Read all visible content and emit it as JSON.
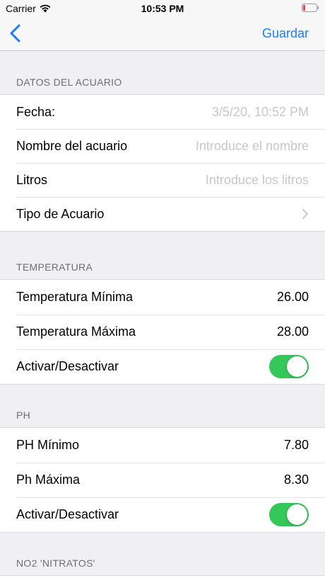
{
  "status": {
    "carrier": "Carrier",
    "time": "10:53 PM",
    "battery_color": "#ff3b30"
  },
  "nav": {
    "save_label": "Guardar",
    "accent": "#1a7cf5"
  },
  "sections": {
    "acuario": {
      "header": "DATOS DEL ACUARIO",
      "fecha_label": "Fecha:",
      "fecha_value": "3/5/20, 10:52 PM",
      "nombre_label": "Nombre del acuario",
      "nombre_placeholder": "Introduce el nombre",
      "litros_label": "Litros",
      "litros_placeholder": "Introduce los litros",
      "tipo_label": "Tipo de Acuario"
    },
    "temperatura": {
      "header": "TEMPERATURA",
      "min_label": "Temperatura Mínima",
      "min_value": "26.00",
      "max_label": "Temperatura Máxima",
      "max_value": "28.00",
      "toggle_label": "Activar/Desactivar",
      "toggle_on": true
    },
    "ph": {
      "header": "PH",
      "min_label": "PH Mínimo",
      "min_value": "7.80",
      "max_label": "Ph Máxima",
      "max_value": "8.30",
      "toggle_label": "Activar/Desactivar",
      "toggle_on": true
    },
    "no2": {
      "header": "NO2 'NITRATOS'"
    }
  },
  "toggle_color": "#34c759"
}
